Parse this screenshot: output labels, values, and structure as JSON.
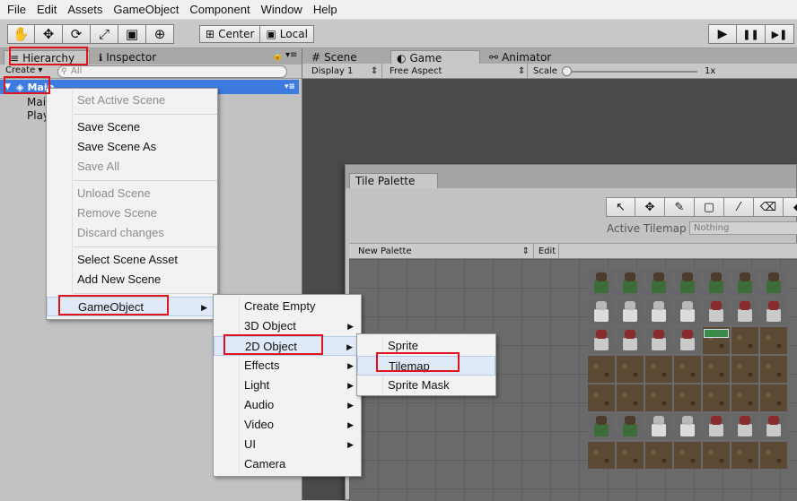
{
  "menubar": {
    "items": [
      "File",
      "Edit",
      "Assets",
      "GameObject",
      "Component",
      "Window",
      "Help"
    ]
  },
  "toolbar": {
    "tools": [
      {
        "name": "hand-tool",
        "glyph": "✋"
      },
      {
        "name": "move-tool",
        "glyph": "✥"
      },
      {
        "name": "rotate-tool",
        "glyph": "⟳"
      },
      {
        "name": "scale-tool",
        "glyph": "⤢"
      },
      {
        "name": "rect-tool",
        "glyph": "▣"
      },
      {
        "name": "transform-tool",
        "glyph": "⊕"
      }
    ],
    "pivot_label": "Center",
    "space_label": "Local",
    "play": "▶",
    "pause": "❚❚",
    "step": "▶❚"
  },
  "left_tabs": {
    "hierarchy": "Hierarchy",
    "inspector": "Inspector"
  },
  "hierarchy": {
    "create_label": "Create ▾",
    "search_placeholder": "All",
    "scene_name": "Main",
    "items": [
      "Mai",
      "Play"
    ]
  },
  "right_tabs": {
    "scene": "Scene",
    "game": "Game",
    "animator": "Animator"
  },
  "game_toolbar": {
    "display": "Display 1",
    "aspect": "Free Aspect",
    "scale_label": "Scale",
    "scale_value": "1x"
  },
  "tile_palette": {
    "tab_label": "Tile Palette",
    "active_tilemap_label": "Active Tilemap",
    "active_tilemap_value": "Nothing",
    "palette_name": "New Palette",
    "edit_label": "Edit"
  },
  "context_menu": {
    "items": [
      {
        "label": "Set Active Scene",
        "disabled": true
      },
      {
        "label": "Save Scene",
        "disabled": false
      },
      {
        "label": "Save Scene As",
        "disabled": false
      },
      {
        "label": "Save All",
        "disabled": true
      },
      {
        "label": "Unload Scene",
        "disabled": true
      },
      {
        "label": "Remove Scene",
        "disabled": true
      },
      {
        "label": "Discard changes",
        "disabled": true
      },
      {
        "label": "Select Scene Asset",
        "disabled": false
      },
      {
        "label": "Add New Scene",
        "disabled": false
      },
      {
        "label": "GameObject",
        "disabled": false
      }
    ]
  },
  "gameobject_menu": {
    "items": [
      "Create Empty",
      "3D Object",
      "2D Object",
      "Effects",
      "Light",
      "Audio",
      "Video",
      "UI",
      "Camera"
    ]
  },
  "object2d_menu": {
    "items": [
      "Sprite",
      "Tilemap",
      "Sprite Mask"
    ]
  },
  "colors": {
    "selection": "#3d7be0",
    "highlight_box": "#e0141e",
    "menu_hover": "#dfe9f7"
  }
}
